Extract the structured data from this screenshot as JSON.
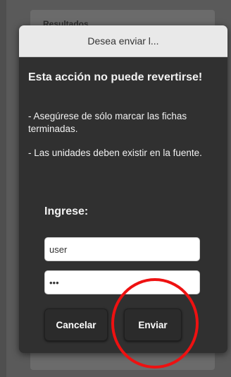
{
  "background": {
    "card_title": "Resultados"
  },
  "dialog": {
    "title": "Desea enviar l...",
    "warning_title": "Esta acción no puede revertirse!",
    "notes": [
      "- Asegúrese de sólo marcar las fichas terminadas.",
      "- Las unidades deben existir en la fuente."
    ],
    "form_label": "Ingrese:",
    "username_value": "user",
    "password_value": "•••",
    "cancel_label": "Cancelar",
    "send_label": "Enviar"
  },
  "colors": {
    "overlay": "#5a5a5a",
    "dialog_bg": "#303030",
    "header_bg": "#e9e9e9",
    "annotation": "#ee1111"
  }
}
